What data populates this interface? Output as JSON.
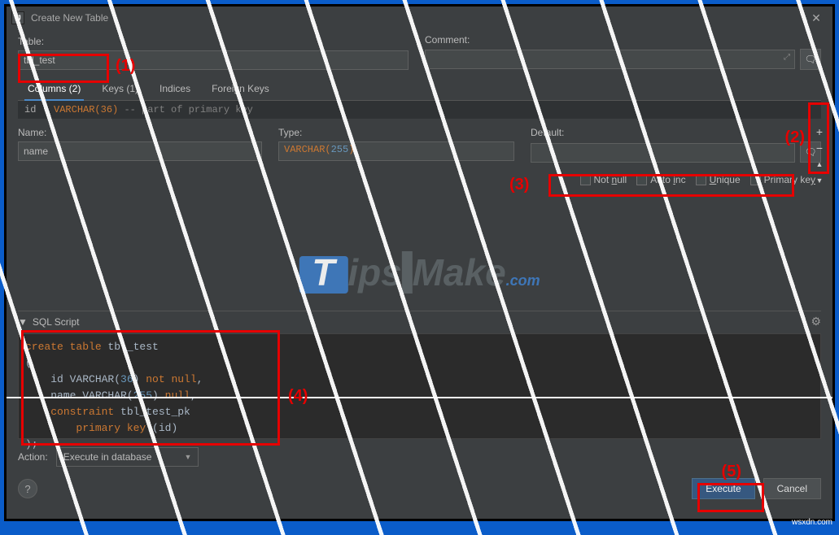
{
  "window": {
    "title": "Create New Table",
    "close": "✕"
  },
  "labels": {
    "table": "Table:",
    "comment": "Comment:",
    "name": "Name:",
    "type": "Type:",
    "default": "Default:",
    "sql_script": "SQL Script",
    "action": "Action:"
  },
  "fields": {
    "table_name": "tbl_test",
    "comment": "",
    "col_name": "name",
    "col_type_prefix": "VARCHAR(",
    "col_type_num": "255",
    "col_type_suffix": ")",
    "col_default": ""
  },
  "tabs": [
    {
      "label": "Columns (2)",
      "active": true
    },
    {
      "label": "Keys (1)",
      "active": false
    },
    {
      "label": "Indices",
      "active": false
    },
    {
      "label": "Foreign Keys",
      "active": false
    }
  ],
  "definition_row": {
    "id": "id",
    "type": "VARCHAR(36)",
    "comment": " -- part of primary key"
  },
  "constraints": {
    "not_null": "Not null",
    "auto_inc": "Auto inc",
    "unique": "Unique",
    "primary_key": "Primary key"
  },
  "side_tools": {
    "add": "+",
    "remove": "−",
    "up": "▲",
    "down": "▼"
  },
  "sql": {
    "line1_kw": "create table ",
    "line1_name": "tbl_test",
    "line2": "(",
    "line3a": "    id VARCHAR(",
    "line3n": "36",
    "line3b": ") ",
    "line3kw": "not null",
    "line3c": ",",
    "line4a": "    name VARCHAR(",
    "line4n": "255",
    "line4b": ") ",
    "line4kw": "null",
    "line4c": ",",
    "line5a": "    ",
    "line5kw": "constraint ",
    "line5b": "tbl_test_pk",
    "line6a": "        ",
    "line6kw": "primary key ",
    "line6b": "(id)",
    "line7": ");"
  },
  "action_value": "Execute in database",
  "buttons": {
    "execute": "Execute",
    "cancel": "Cancel"
  },
  "annotations": {
    "a1": "(1)",
    "a2": "(2)",
    "a3": "(3)",
    "a4": "(4)",
    "a5": "(5)"
  },
  "watermark": {
    "t": "T",
    "ips": "ips",
    "m": "M",
    "ake": "ake",
    "dotcom": ".com"
  },
  "attrib": "wsxdn.com"
}
